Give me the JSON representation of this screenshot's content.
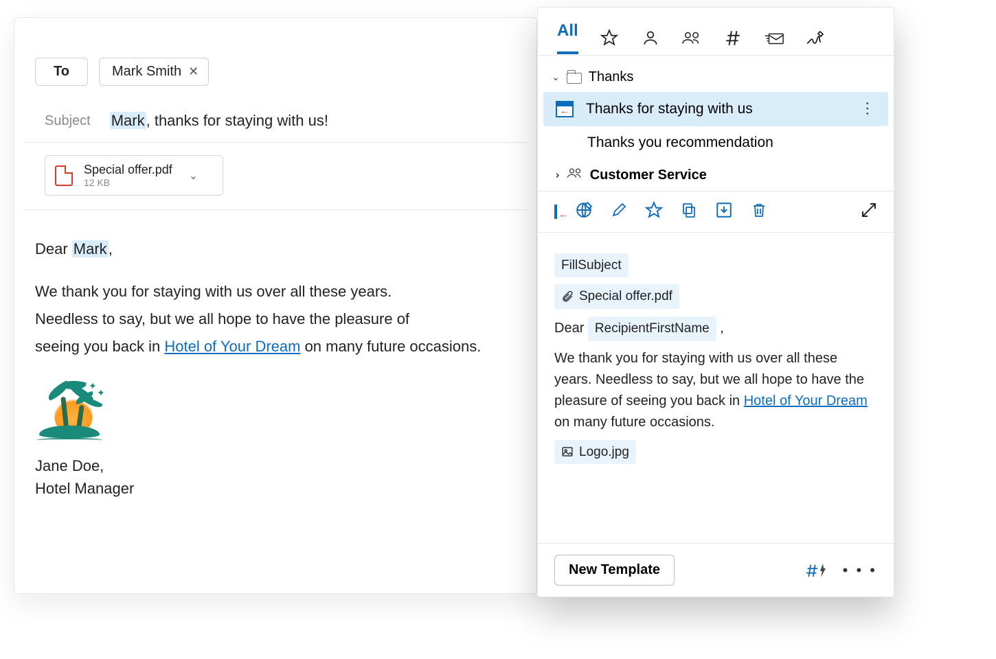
{
  "compose": {
    "to_label": "To",
    "recipient_chip": "Mark Smith",
    "subject_label": "Subject",
    "subject_highlight_name": "Mark",
    "subject_rest": ", thanks for staying with us!",
    "attachment": {
      "name": "Special offer.pdf",
      "size": "12 KB"
    },
    "body": {
      "greeting_prefix": "Dear ",
      "greeting_name": "Mark",
      "greeting_suffix": ",",
      "line1": "We thank you for staying with us over all these years.",
      "line2": "Needless to say, but we all hope to have the pleasure of",
      "line3_pre": "seeing you back in ",
      "link_text": "Hotel of Your Dream",
      "line3_post": " on many future occasions."
    },
    "signature": {
      "name": "Jane Doe,",
      "title": "Hotel Manager"
    }
  },
  "templates": {
    "tab_all": "All",
    "folder_thanks": "Thanks",
    "item_selected": "Thanks for staying with us",
    "item_other": "Thanks you recommendation",
    "folder_customer": "Customer Service",
    "preview": {
      "fill_subject": "FillSubject",
      "attachment": "Special offer.pdf",
      "greeting_prefix": "Dear ",
      "recipient_macro": "RecipientFirstName",
      "greeting_suffix": " ,",
      "body_pre": "We thank you for staying with us over all these years. Needless to say, but we all hope to have the pleasure of seeing you back in ",
      "link_text": "Hotel of Your Dream",
      "body_post": " on many future occasions.",
      "logo_file": "Logo.jpg"
    },
    "new_template": "New Template"
  }
}
